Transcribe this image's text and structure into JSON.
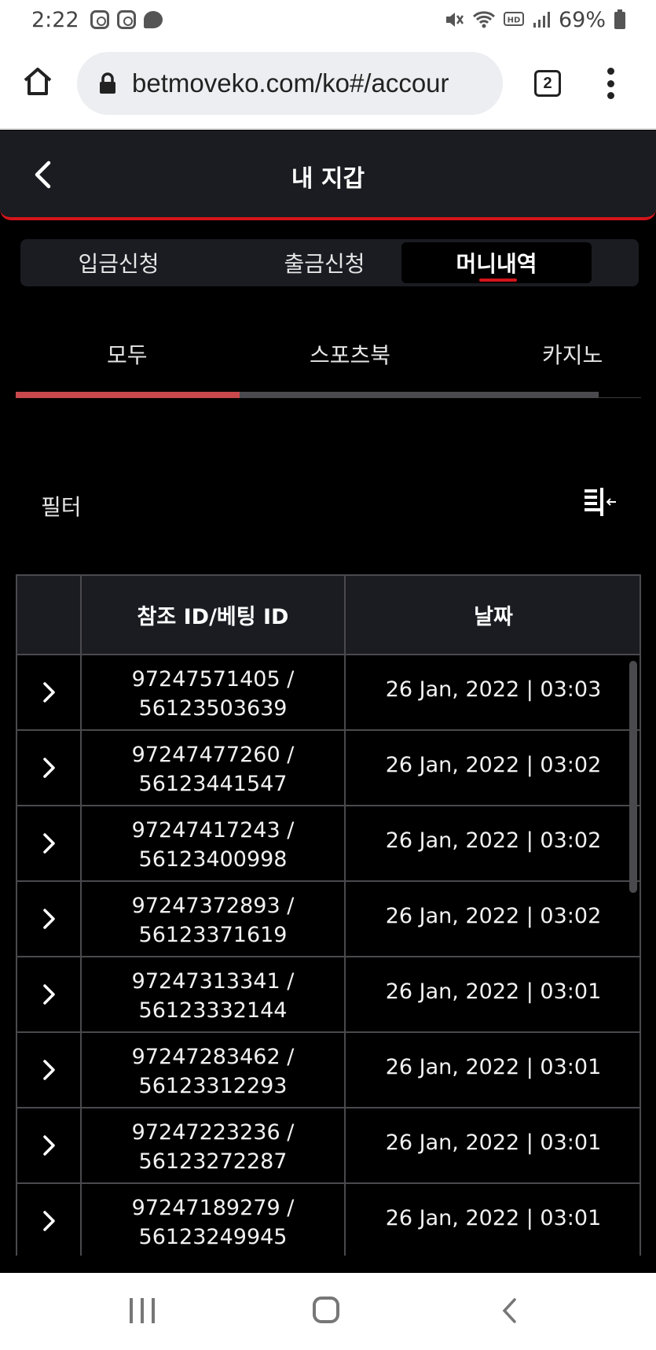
{
  "status_bar": {
    "time": "2:22",
    "battery": "69%",
    "icons": [
      "instagram-icon",
      "instagram-icon",
      "chat-icon",
      "mute-icon",
      "wifi-icon",
      "hd-icon",
      "signal-icon",
      "battery-icon"
    ]
  },
  "browser": {
    "url": "betmoveko.com/ko#/accour",
    "tab_count": "2"
  },
  "header": {
    "title": "내 지갑"
  },
  "main_tabs": [
    {
      "label": "입금신청",
      "active": false
    },
    {
      "label": "출금신청",
      "active": false
    },
    {
      "label": "머니내역",
      "active": true
    }
  ],
  "sub_tabs": [
    {
      "label": "모두",
      "active": true
    },
    {
      "label": "스포츠북",
      "active": false
    },
    {
      "label": "카지노",
      "active": false
    }
  ],
  "filter": {
    "label": "필터"
  },
  "table": {
    "columns": [
      "",
      "참조 ID/베팅 ID",
      "날짜"
    ],
    "rows": [
      {
        "ref_id": "97247571405 /",
        "bet_id": "56123503639",
        "date": "26 Jan, 2022 | 03:03"
      },
      {
        "ref_id": "97247477260 /",
        "bet_id": "56123441547",
        "date": "26 Jan, 2022 | 03:02"
      },
      {
        "ref_id": "97247417243 /",
        "bet_id": "56123400998",
        "date": "26 Jan, 2022 | 03:02"
      },
      {
        "ref_id": "97247372893 /",
        "bet_id": "56123371619",
        "date": "26 Jan, 2022 | 03:02"
      },
      {
        "ref_id": "97247313341 /",
        "bet_id": "56123332144",
        "date": "26 Jan, 2022 | 03:01"
      },
      {
        "ref_id": "97247283462 /",
        "bet_id": "56123312293",
        "date": "26 Jan, 2022 | 03:01"
      },
      {
        "ref_id": "97247223236 /",
        "bet_id": "56123272287",
        "date": "26 Jan, 2022 | 03:01"
      },
      {
        "ref_id": "97247189279 /",
        "bet_id": "56123249945",
        "date": "26 Jan, 2022 | 03:01"
      }
    ]
  },
  "colors": {
    "accent": "#d3141b",
    "panel": "#1b1c22",
    "background": "#000000",
    "border": "#4a4a4e"
  }
}
